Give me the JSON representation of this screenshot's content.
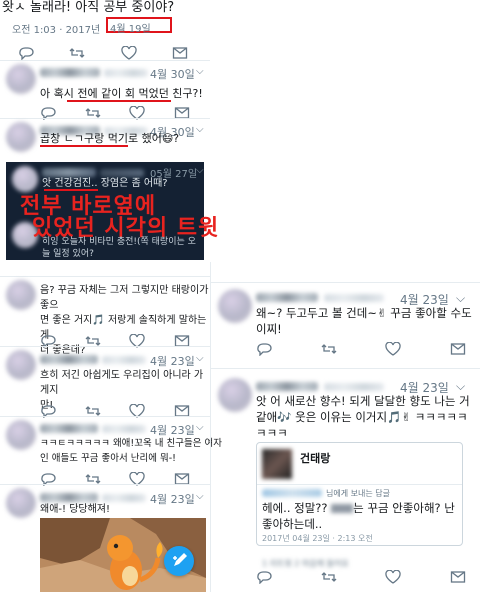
{
  "top": {
    "text": "왓ㅅ 놀래라! 아직 공부 중이야?",
    "time": "오전 1:03 · 2017년",
    "date_boxed": "4월 19일"
  },
  "colors": {
    "accent": "#1da1f2",
    "red": "#e0141b",
    "dark_panel": "#142133",
    "banner_text": "#e8231f"
  },
  "left_replies": [
    {
      "date": "4월 30일",
      "body_before": "아 혹시 ",
      "body_underlined": "전에 같이 회 먹었던 친구?!",
      "body_after": ""
    },
    {
      "date": "4월 30일",
      "body_underlined": "곱창 ㄴㄱ구랑 먹기로 했어",
      "body_after": "😄?"
    }
  ],
  "dark_panel": {
    "date": "05월 27일",
    "line1_underlined": "앗 건강검진..",
    "line1_rest": " 장염은 좀 어때?",
    "banner_line1": "전부 바로옆에",
    "banner_line2": "있었던 시각의 트윗",
    "line2": "히잉 오늘자 비타민 충전!(쪽 태랑이는 오늘 일정 있어?"
  },
  "left_tweets": [
    {
      "date": "",
      "lines": [
        "음? 꾸금 자체는 그저 그렇지만 태랑이가 좋으",
        "면 좋은 거지🎵 저랑게 솔직하게 말하는 게",
        "더 좋은데?"
      ]
    },
    {
      "date": "4월 23일",
      "lines": [
        "흐히 저긴 아쉽게도 우리집이 아니라 가게지",
        "만!"
      ]
    },
    {
      "date": "4월 23일",
      "lines": [
        "ㅋㅋㅌㅋㅋㅋㅋㅋ 왜애!꼬옥 내 친구들은 여자",
        "인 애들도 꾸금 좋아서 난리에 뭐-!"
      ]
    },
    {
      "date": "4월 23일",
      "lines": [
        "왜애-! 당당해져!"
      ]
    }
  ],
  "right_tweets": [
    {
      "date": "4월 23일",
      "lines": [
        "왜~? 두고두고 볼 건데~✌ 꾸금 좋아할 수도",
        "이찌!"
      ]
    },
    {
      "date": "4월 23일",
      "lines": [
        "앗 어 새로산 향수! 되게 달달한 향도 나는 거",
        "같애🎶 웃은 이유는 이거지🎵✌ ㅋㅋㅋㅋㅋ",
        "ㅋㅋㅋ"
      ]
    }
  ],
  "quoted": {
    "name": "건태랑",
    "reply_label": "님에게 보내는 답글",
    "lines": [
      "헤에.. 정말?? ",
      1,
      "는 꾸금 안좋아해? 난",
      "좋아하는데.."
    ],
    "line1a": "헤에.. 정말?? ",
    "line1b": "는 꾸금 안좋아해? 난",
    "line2": "좋아하는데..",
    "timestamp": "2017년 04월 23일 · 2:13 오전",
    "footer": "1 리트윗   2 마음에 들어요"
  },
  "icons": [
    "reply-icon",
    "retweet-icon",
    "heart-icon",
    "dm-icon",
    "chevron-down-icon",
    "compose-icon"
  ]
}
